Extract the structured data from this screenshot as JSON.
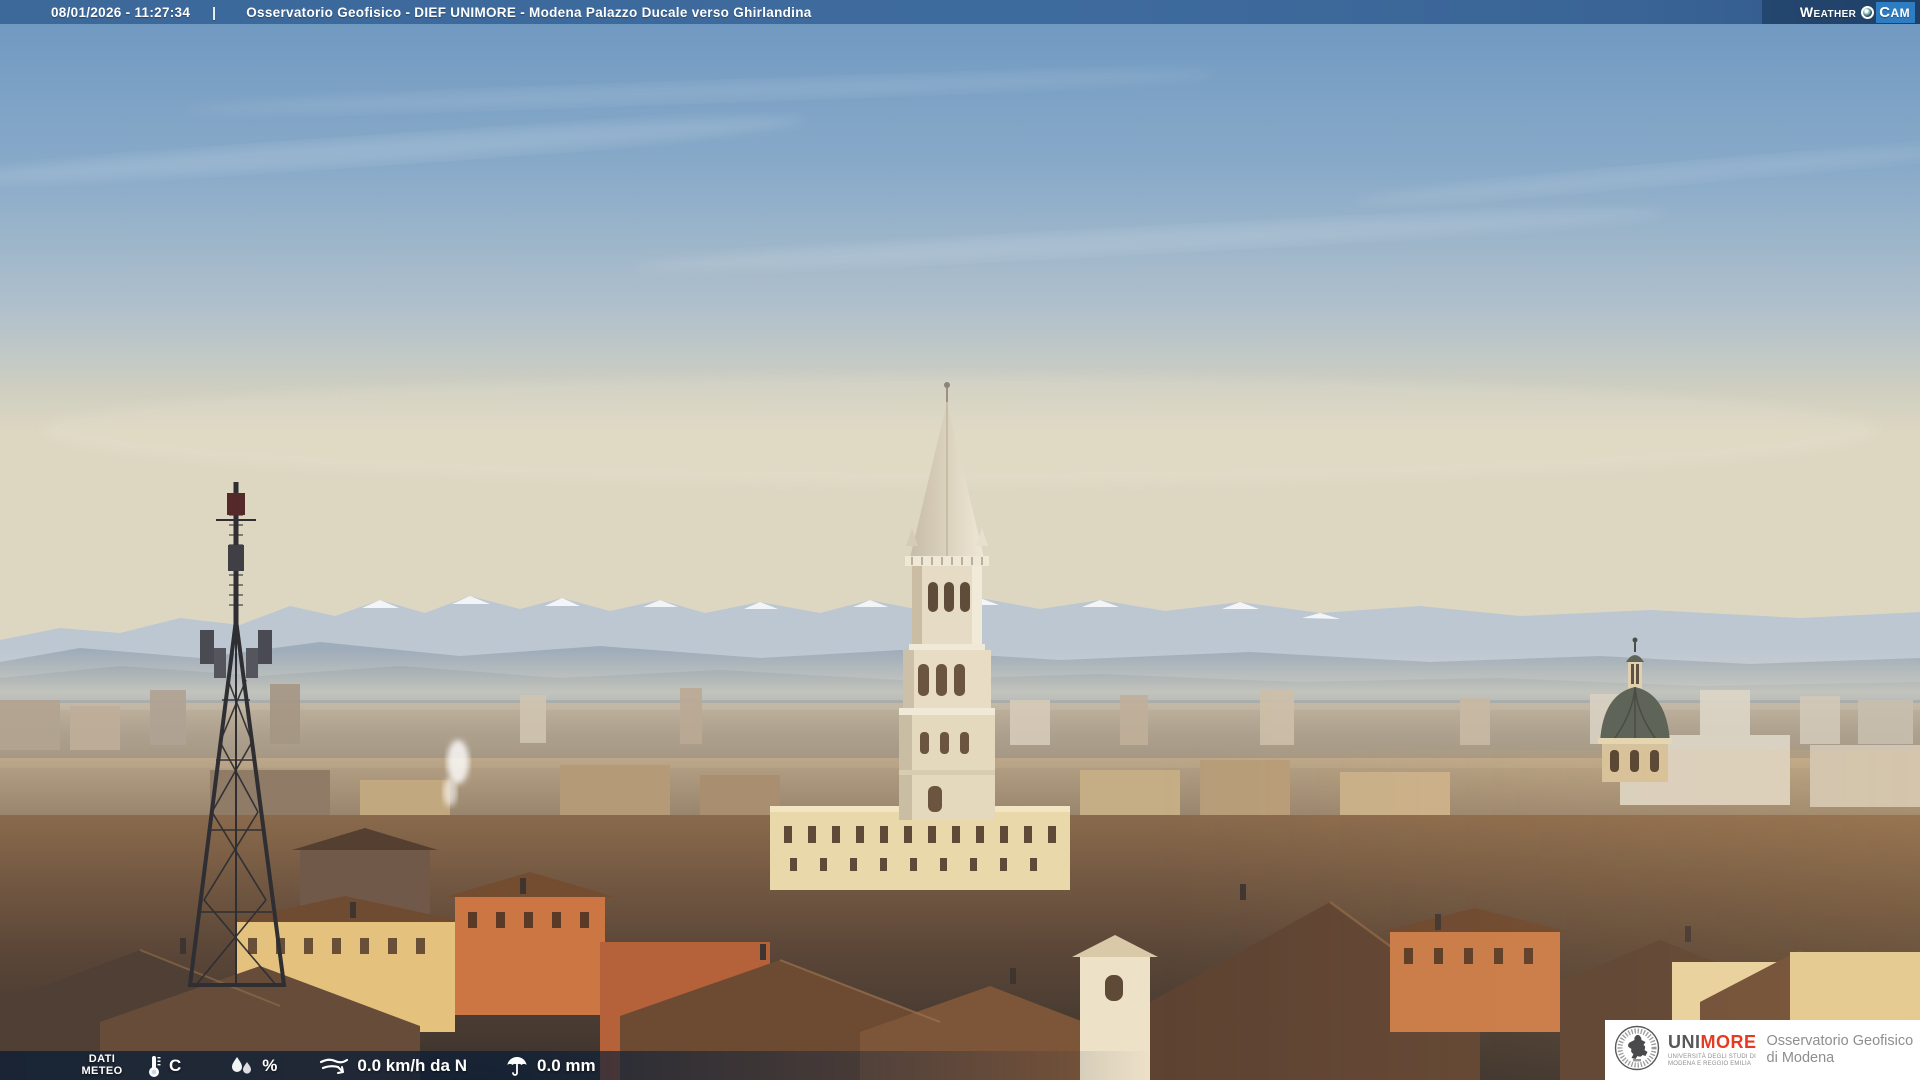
{
  "top_bar": {
    "datetime": "08/01/2026 - 11:27:34",
    "separator": "|",
    "title": "Osservatorio Geofisico - DIEF UNIMORE - Modena Palazzo Ducale verso Ghirlandina",
    "bg_color": "#3d689a",
    "text_color": "#ffffff"
  },
  "weathercam": {
    "word1": "Weather",
    "word2": "Cam",
    "cam_box_color": "#2e7cc2",
    "panel_color": "#1f3f66"
  },
  "meteo": {
    "label_line1": "DATI",
    "label_line2": "METEO",
    "temperature": {
      "value": "",
      "unit": "C",
      "icon": "thermometer-icon"
    },
    "humidity": {
      "value": "",
      "unit": "%",
      "icon": "humidity-drops-icon"
    },
    "wind": {
      "text": "0.0 km/h da N",
      "icon": "wind-icon"
    },
    "rain": {
      "text": "0.0 mm",
      "icon": "umbrella-icon"
    },
    "bar_color": "rgba(12,30,54,0.8)"
  },
  "logo_box": {
    "brand_uni": "UNI",
    "brand_more": "MORE",
    "brand_more_color": "#e63b23",
    "subtitle_line1": "UNIVERSITÀ DEGLI STUDI DI",
    "subtitle_line2": "MODENA E REGGIO EMILIA",
    "right_line1": "Osservatorio Geofisico",
    "right_line2": "di Modena",
    "bg_color": "#ffffff"
  },
  "scene_colors": {
    "sky_top": "#6d97c0",
    "sky_horizon": "#ddd7c2",
    "mountains": "#bcc7d2",
    "snow": "#f5f8fa",
    "roofs": "#6d4b33",
    "sunlit_facade": "#e9d8aa",
    "tower_stone": "#e6dcc4"
  }
}
